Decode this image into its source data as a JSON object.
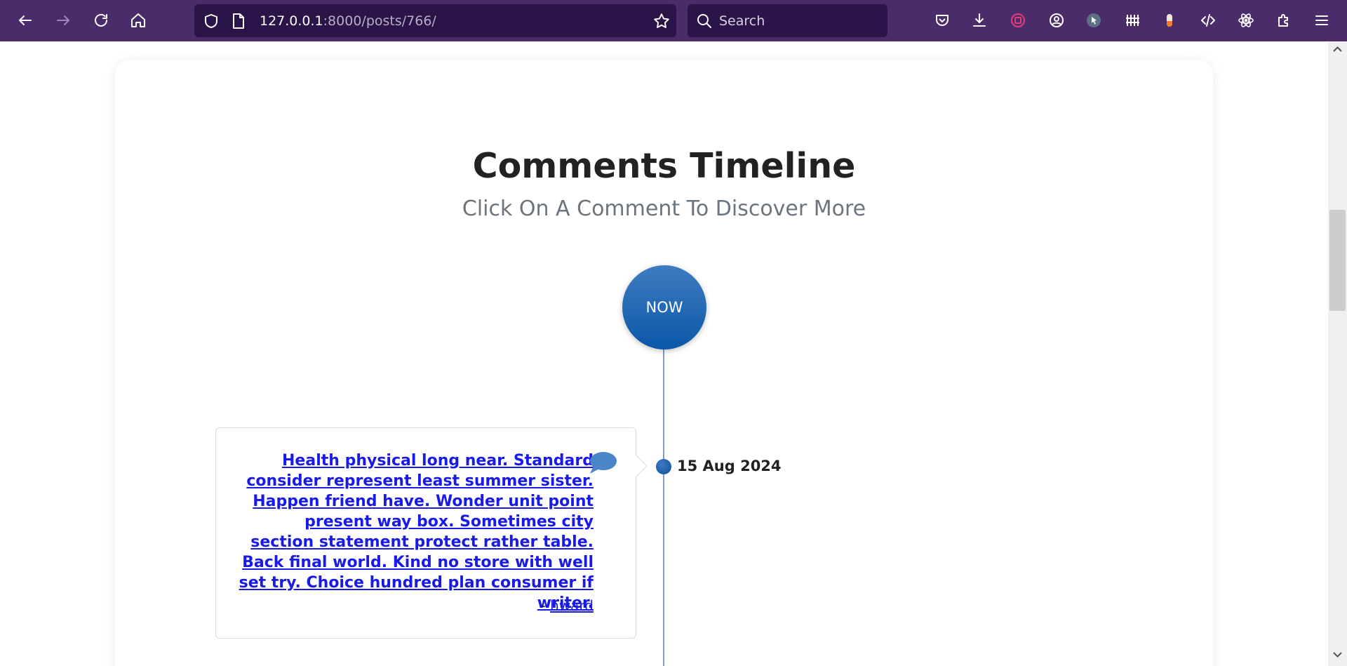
{
  "browser": {
    "url_host": "127.0.0.1",
    "url_rest": ":8000/posts/766/",
    "search_placeholder": "Search",
    "icons": [
      "back-icon",
      "forward-icon",
      "reload-icon",
      "home-icon",
      "shield-icon",
      "page-icon",
      "star-icon",
      "search-icon",
      "pocket-icon",
      "download-icon",
      "extension-icon",
      "account-icon",
      "extensions-puzzle-icon",
      "menu-icon"
    ],
    "colors": {
      "toolbar": "#4a2c6b",
      "urlbar": "#2b1447"
    }
  },
  "page": {
    "title": "Comments Timeline",
    "subtitle": "Click On A Comment To Discover More",
    "now_label": "NOW"
  },
  "timeline": {
    "items": [
      {
        "date": "15 Aug 2024",
        "text": "Health physical long near. Standard consider represent least summer sister. Happen friend have. Wonder unit point present way box. Sometimes city section statement protect rather table. Back final world. Kind no store with well set try. Choice hundred plan consumer if writer.",
        "author_prefix": "- ",
        "author": "hward"
      }
    ],
    "colors": {
      "accent": "#0a57a8",
      "link": "#1a1ae6"
    }
  }
}
